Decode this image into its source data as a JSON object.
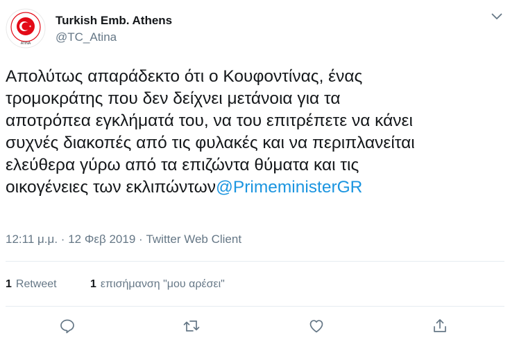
{
  "author": {
    "display_name": "Turkish Emb. Athens",
    "handle": "@TC_Atina",
    "avatar_text": "ATINA"
  },
  "tweet": {
    "lines": [
      "Απολύτως απαράδεκτο ότι ο Κουφοντίνας, ένας",
      "τρομοκράτης που δεν δείχνει μετάνοια για τα",
      "αποτρόπεα εγκλήματά του, να του επιτρέπετε να κάνει",
      "συχνές διακοπές από τις φυλακές και να περιπλανείται",
      "ελεύθερα γύρω από τα επιζώντα θύματα και τις",
      "οικογένειες των εκλιπώντων"
    ],
    "mention": "@PrimeministerGR"
  },
  "meta": {
    "time": "12:11 μ.μ.",
    "separator": "·",
    "date": "12 Φεβ 2019",
    "client": "Twitter Web Client"
  },
  "stats": {
    "retweets_count": "1",
    "retweets_label": "Retweet",
    "likes_count": "1",
    "likes_label": "επισήμανση \"μου αρέσει\""
  },
  "colors": {
    "mention_blue": "#1b95e0",
    "secondary_gray": "#657786",
    "flag_red": "#e30a17"
  },
  "icons": [
    "chevron-down-icon",
    "reply-icon",
    "retweet-icon",
    "like-icon",
    "share-icon"
  ]
}
